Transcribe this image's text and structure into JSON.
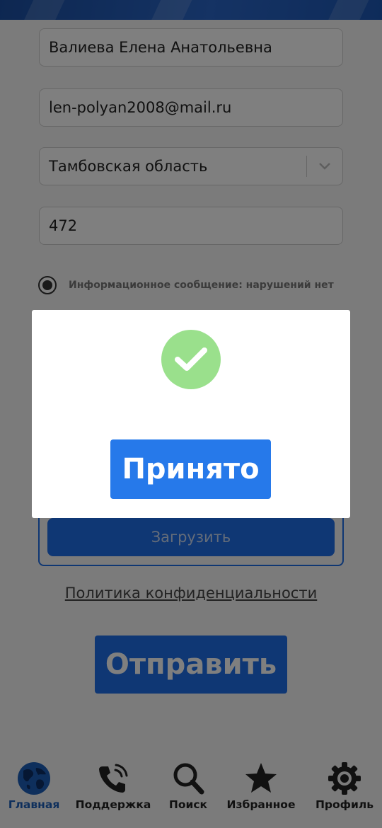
{
  "form": {
    "name_value": "Валиева Елена Анатольевна",
    "email_value": "len-polyan2008@mail.ru",
    "region_value": "Тамбовская область",
    "number_value": "472",
    "radio_label": "Информационное сообщение: нарушений нет",
    "upload_label": "Загрузить",
    "policy_link": "Политика конфиденциальности",
    "send_label": "Отправить"
  },
  "dialog": {
    "icon": "check-icon",
    "ok_label": "Принято"
  },
  "bottom_nav": {
    "active": "Главная",
    "items": [
      {
        "label": "Главная",
        "icon": "globe-icon"
      },
      {
        "label": "Поддержка",
        "icon": "phone-icon"
      },
      {
        "label": "Поиск",
        "icon": "search-icon"
      },
      {
        "label": "Избранное",
        "icon": "star-icon"
      },
      {
        "label": "Профиль",
        "icon": "gear-icon"
      }
    ]
  },
  "colors": {
    "accent": "#1e6ee8",
    "banner": "#1b4fa3",
    "success": "#9ae08c",
    "active_nav": "#1c5fb8"
  }
}
